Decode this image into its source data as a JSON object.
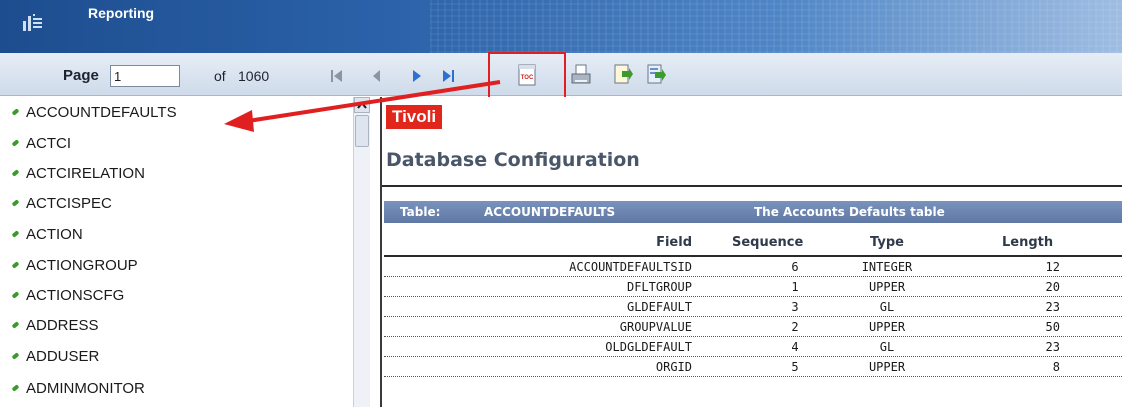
{
  "header": {
    "title": "Reporting",
    "logo_icon": "report-app-icon"
  },
  "toolbar": {
    "page_label": "Page",
    "page_value": "1",
    "of_label": "of",
    "total_pages": "1060",
    "nav_icons": [
      "first-page-icon",
      "previous-page-icon",
      "next-page-icon",
      "last-page-icon"
    ],
    "tool_icons": [
      "toc-icon",
      "print-icon",
      "export-icon",
      "export-data-icon"
    ],
    "highlight_color": "#e02020"
  },
  "toc": {
    "items": [
      "ACCOUNTDEFAULTS",
      "ACTCI",
      "ACTCIRELATION",
      "ACTCISPEC",
      "ACTION",
      "ACTIONGROUP",
      "ACTIONSCFG",
      "ADDRESS",
      "ADDUSER",
      "ADMINMONITOR"
    ],
    "bullet_color": "#3b9a2b"
  },
  "report": {
    "brand": "Tivoli",
    "brand_color": "#e1261c",
    "title": "Database Configuration",
    "table_band": {
      "table_label": "Table:",
      "table_name": "ACCOUNTDEFAULTS",
      "description": "The Accounts Defaults table"
    },
    "columns": [
      "Field",
      "Sequence",
      "Type",
      "Length"
    ],
    "rows": [
      {
        "field": "ACCOUNTDEFAULTSID",
        "sequence": "6",
        "type": "INTEGER",
        "length": "12"
      },
      {
        "field": "DFLTGROUP",
        "sequence": "1",
        "type": "UPPER",
        "length": "20"
      },
      {
        "field": "GLDEFAULT",
        "sequence": "3",
        "type": "GL",
        "length": "23"
      },
      {
        "field": "GROUPVALUE",
        "sequence": "2",
        "type": "UPPER",
        "length": "50"
      },
      {
        "field": "OLDGLDEFAULT",
        "sequence": "4",
        "type": "GL",
        "length": "23"
      },
      {
        "field": "ORGID",
        "sequence": "5",
        "type": "UPPER",
        "length": "8"
      }
    ]
  }
}
